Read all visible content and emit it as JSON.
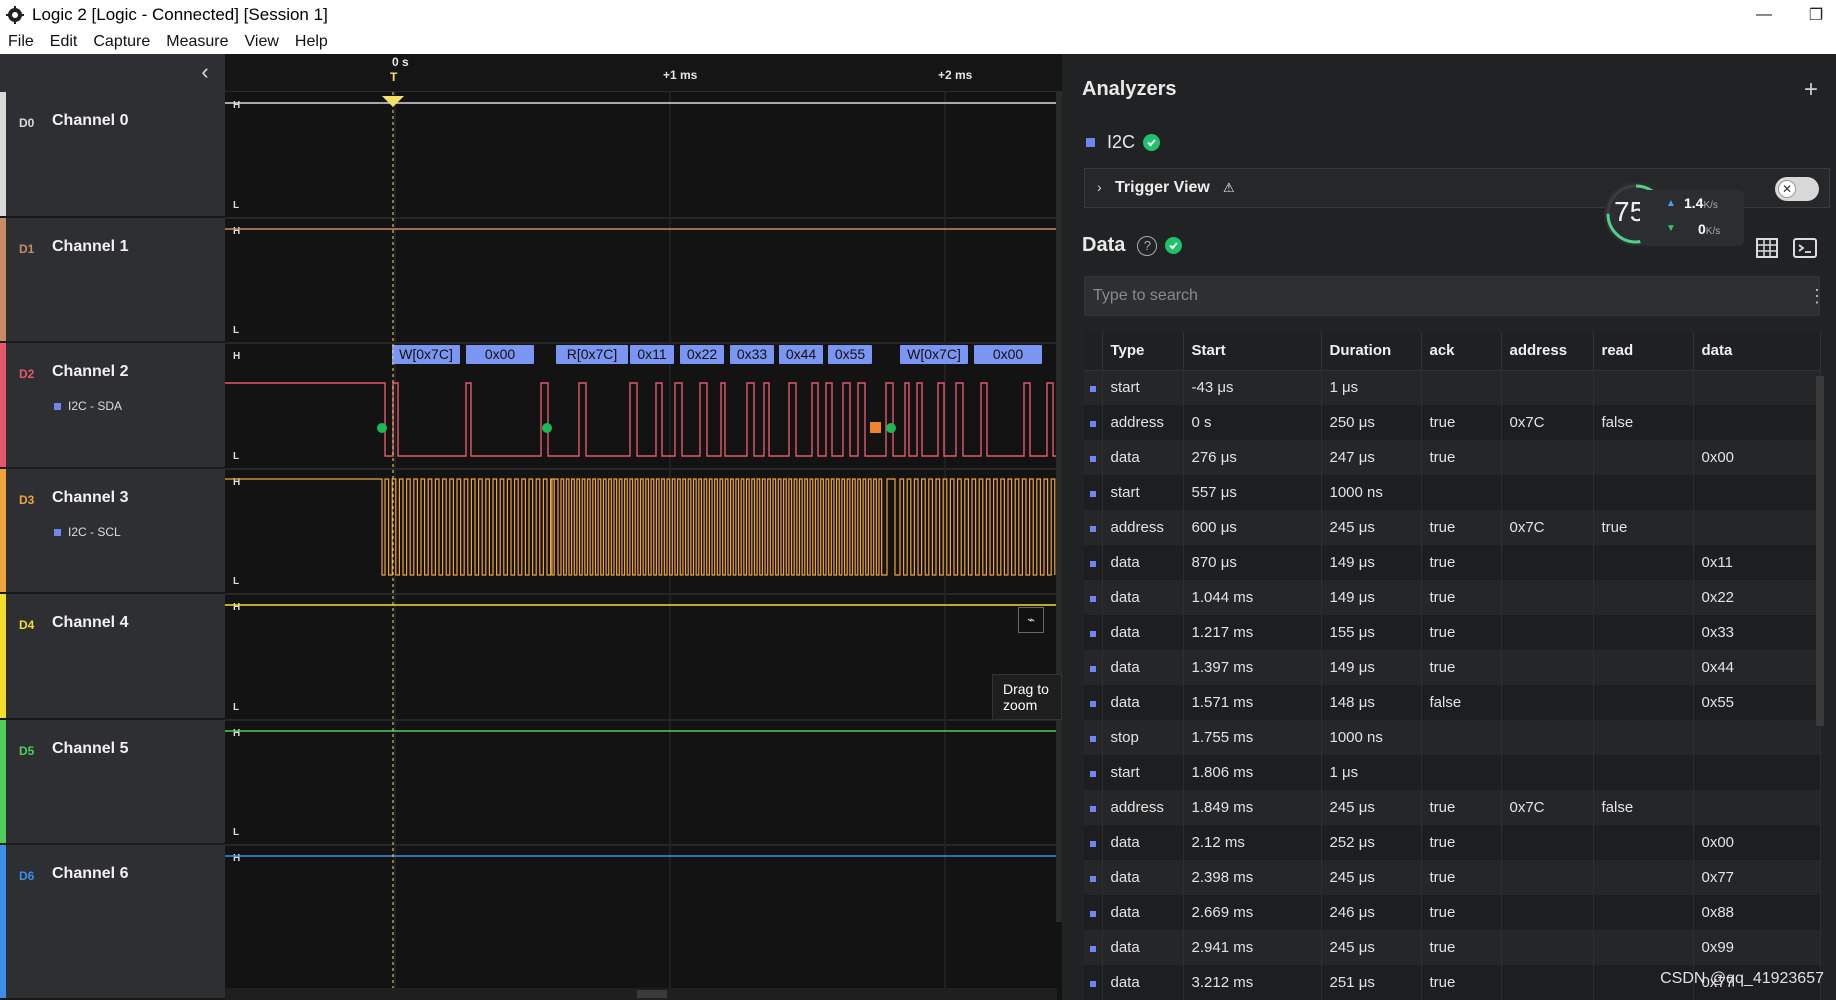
{
  "window": {
    "title": "Logic 2 [Logic - Connected] [Session 1]",
    "minimize": "—",
    "restore": "❐"
  },
  "menu": [
    "File",
    "Edit",
    "Capture",
    "Measure",
    "View",
    "Help"
  ],
  "timeline": {
    "collapse_icon": "chevron-left-icon",
    "labels": {
      "zero": "0 s",
      "trigger": "T",
      "plus1": "+1 ms",
      "plus2": "+2 ms"
    }
  },
  "channels": [
    {
      "tag": "D0",
      "name": "Channel 0",
      "color": "#d9d9d9",
      "analyzer": ""
    },
    {
      "tag": "D1",
      "name": "Channel 1",
      "color": "#c98b64",
      "analyzer": ""
    },
    {
      "tag": "D2",
      "name": "Channel 2",
      "color": "#e4586a",
      "analyzer": "I2C - SDA"
    },
    {
      "tag": "D3",
      "name": "Channel 3",
      "color": "#f0a33b",
      "analyzer": "I2C - SCL"
    },
    {
      "tag": "D4",
      "name": "Channel 4",
      "color": "#f3de2c",
      "analyzer": ""
    },
    {
      "tag": "D5",
      "name": "Channel 5",
      "color": "#4ccf5c",
      "analyzer": ""
    },
    {
      "tag": "D6",
      "name": "Channel 6",
      "color": "#3b8fe8",
      "analyzer": ""
    }
  ],
  "level_labels": {
    "high": "H",
    "low": "L"
  },
  "decode_bubbles": [
    "W[0x7C]",
    "0x00",
    "R[0x7C]",
    "0x11",
    "0x22",
    "0x33",
    "0x44",
    "0x55",
    "W[0x7C]",
    "0x00"
  ],
  "tooltip": "Drag to zoom",
  "analyzers": {
    "title": "Analyzers",
    "add_icon": "plus-icon",
    "items": [
      {
        "name": "I2C",
        "status": "check-icon"
      }
    ],
    "trigger_view": {
      "label": "Trigger View",
      "warning": "⚠"
    }
  },
  "net_widget": {
    "percent": "75",
    "percent_unit": "%",
    "up": "1.4",
    "up_unit": "K/s",
    "down": "0",
    "down_unit": "K/s"
  },
  "data_panel": {
    "title": "Data",
    "help": "?",
    "search_placeholder": "Type to search",
    "columns": [
      "Type",
      "Start",
      "Duration",
      "ack",
      "address",
      "read",
      "data"
    ],
    "rows": [
      [
        "start",
        "-43 μs",
        "1 μs",
        "",
        "",
        "",
        ""
      ],
      [
        "address",
        "0 s",
        "250 μs",
        "true",
        "0x7C",
        "false",
        ""
      ],
      [
        "data",
        "276 μs",
        "247 μs",
        "true",
        "",
        "",
        "0x00"
      ],
      [
        "start",
        "557 μs",
        "1000 ns",
        "",
        "",
        "",
        ""
      ],
      [
        "address",
        "600 μs",
        "245 μs",
        "true",
        "0x7C",
        "true",
        ""
      ],
      [
        "data",
        "870 μs",
        "149 μs",
        "true",
        "",
        "",
        "0x11"
      ],
      [
        "data",
        "1.044 ms",
        "149 μs",
        "true",
        "",
        "",
        "0x22"
      ],
      [
        "data",
        "1.217 ms",
        "155 μs",
        "true",
        "",
        "",
        "0x33"
      ],
      [
        "data",
        "1.397 ms",
        "149 μs",
        "true",
        "",
        "",
        "0x44"
      ],
      [
        "data",
        "1.571 ms",
        "148 μs",
        "false",
        "",
        "",
        "0x55"
      ],
      [
        "stop",
        "1.755 ms",
        "1000 ns",
        "",
        "",
        "",
        ""
      ],
      [
        "start",
        "1.806 ms",
        "1 μs",
        "",
        "",
        "",
        ""
      ],
      [
        "address",
        "1.849 ms",
        "245 μs",
        "true",
        "0x7C",
        "false",
        ""
      ],
      [
        "data",
        "2.12 ms",
        "252 μs",
        "true",
        "",
        "",
        "0x00"
      ],
      [
        "data",
        "2.398 ms",
        "245 μs",
        "true",
        "",
        "",
        "0x77"
      ],
      [
        "data",
        "2.669 ms",
        "246 μs",
        "true",
        "",
        "",
        "0x88"
      ],
      [
        "data",
        "2.941 ms",
        "245 μs",
        "true",
        "",
        "",
        "0x99"
      ],
      [
        "data",
        "3.212 ms",
        "251 μs",
        "true",
        "",
        "",
        "0x77"
      ]
    ]
  },
  "watermark": "CSDN @qq_41923657"
}
